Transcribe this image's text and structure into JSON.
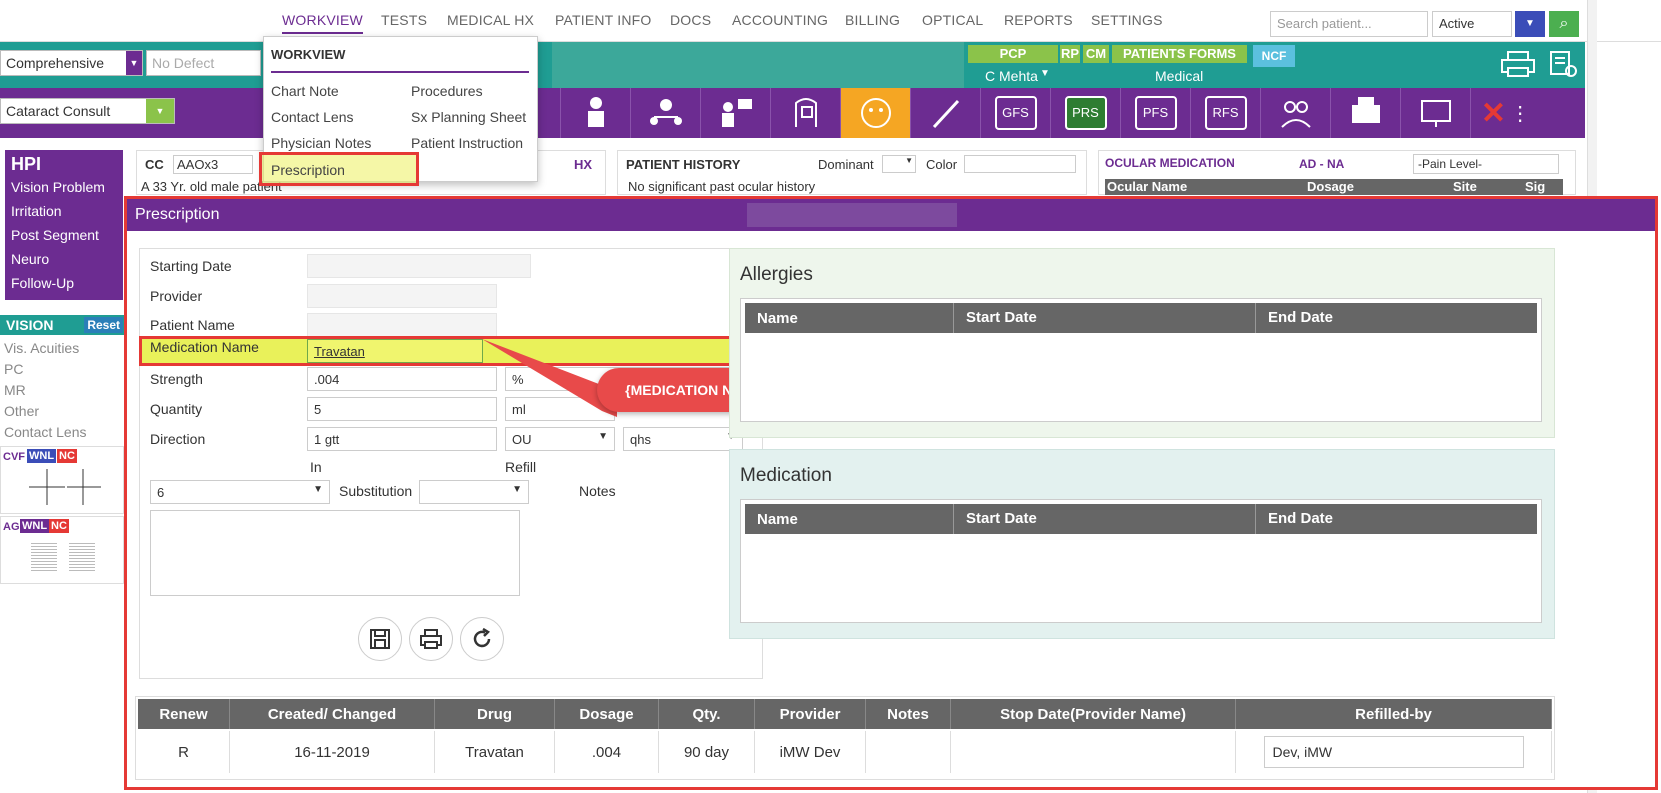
{
  "nav": {
    "items": [
      "WORKVIEW",
      "TESTS",
      "MEDICAL HX",
      "PATIENT INFO",
      "DOCS",
      "ACCOUNTING",
      "BILLING",
      "OPTICAL",
      "REPORTS",
      "SETTINGS"
    ],
    "search_placeholder": "Search patient...",
    "status": "Active"
  },
  "row2": {
    "exam_type": "Comprehensive",
    "defect": "No Defect",
    "pcp": "PCP",
    "rp": "RP",
    "cm": "CM",
    "patients_forms": "PATIENTS FORMS",
    "ncf": "NCF",
    "provider": "C Mehta",
    "insurance": "Medical"
  },
  "row3": {
    "template": "Cataract Consult",
    "tiles": [
      "GFS",
      "PRS",
      "PFS",
      "RFS"
    ]
  },
  "left": {
    "hpi_title": "HPI",
    "hpi_items": [
      "Vision Problem",
      "Irritation",
      "Post Segment",
      "Neuro",
      "Follow-Up"
    ],
    "vision_title": "VISION",
    "reset": "Reset",
    "vision_items": [
      "Vis. Acuities",
      "PC",
      "MR",
      "Other",
      "Contact Lens"
    ],
    "cvf": "CVF",
    "ag": "AG",
    "wnl": "WNL",
    "nc": "NC"
  },
  "background": {
    "cc": "CC",
    "cc_value": "AAOx3",
    "cc_text": "A 33 Yr. old male patient",
    "hx": "HX",
    "patient_history": "PATIENT HISTORY",
    "dominant": "Dominant",
    "color": "Color",
    "history_text": "No significant past ocular history",
    "ocular_medication": "OCULAR MEDICATION",
    "ad_na": "AD - NA",
    "pain_level": "-Pain Level-",
    "ocular_cols": [
      "Ocular Name",
      "Dosage",
      "Site",
      "Sig"
    ]
  },
  "dropdown": {
    "title": "WORKVIEW",
    "col1": [
      "Chart Note",
      "Contact Lens",
      "Physician Notes",
      "Prescription"
    ],
    "col2": [
      "Procedures",
      "Sx Planning Sheet",
      "Patient Instruction"
    ]
  },
  "modal": {
    "title": "Prescription",
    "fields": {
      "starting_date": "Starting Date",
      "provider": "Provider",
      "patient_name": "Patient Name",
      "medication_name": "Medication Name",
      "medication_value": "Travatan",
      "strength": "Strength",
      "strength_value": ".004",
      "strength_unit": "%",
      "quantity": "Quantity",
      "quantity_value": "5",
      "quantity_unit": "ml",
      "direction": "Direction",
      "direction_value": "1 gtt",
      "direction_eye": "OU",
      "direction_freq": "qhs",
      "in": "In",
      "refill": "Refill",
      "in_value": "6",
      "substitution": "Substitution",
      "notes": "Notes"
    },
    "callout": "{MEDICATION NAME}",
    "allergies": {
      "title": "Allergies",
      "cols": [
        "Name",
        "Start Date",
        "End Date"
      ]
    },
    "medication": {
      "title": "Medication",
      "cols": [
        "Name",
        "Start Date",
        "End Date"
      ]
    },
    "rx_table": {
      "cols": [
        "Renew",
        "Created/ Changed",
        "Drug",
        "Dosage",
        "Qty.",
        "Provider",
        "Notes",
        "Stop Date(Provider Name)",
        "Refilled-by"
      ],
      "row": [
        "R",
        "16-11-2019",
        "Travatan",
        ".004",
        "90 day",
        "iMW Dev",
        "",
        "",
        "Dev, iMW"
      ]
    }
  }
}
